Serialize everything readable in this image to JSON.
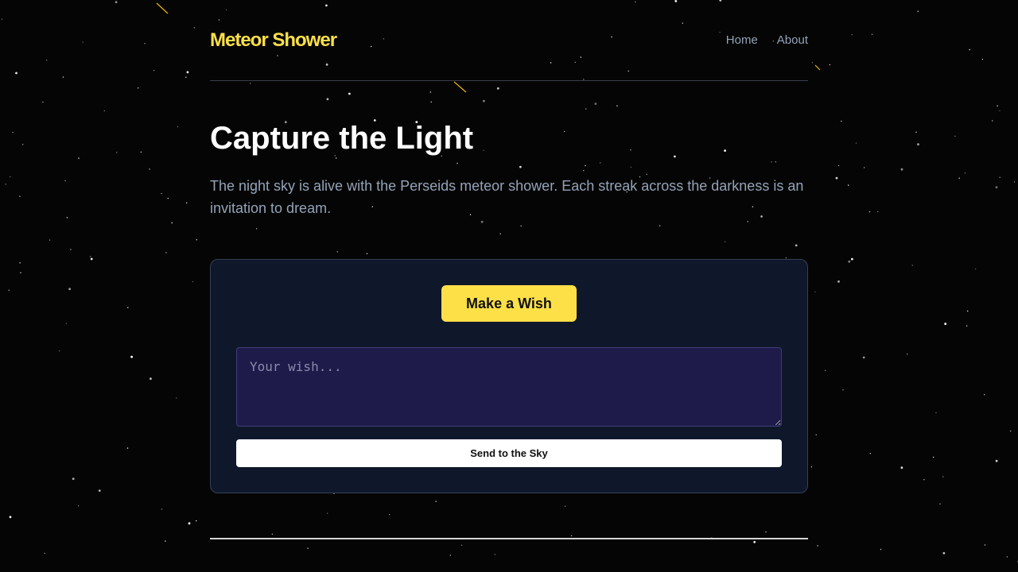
{
  "header": {
    "brand": "Meteor Shower",
    "nav": [
      {
        "label": "Home"
      },
      {
        "label": "About"
      }
    ]
  },
  "hero": {
    "title": "Capture the Light",
    "description": "The night sky is alive with the Perseids meteor shower. Each streak across the darkness is an invitation to dream."
  },
  "wish_card": {
    "wish_button_label": "Make a Wish",
    "wish_placeholder": "Your wish...",
    "send_button_label": "Send to the Sky"
  },
  "colors": {
    "accent": "#fde047",
    "background": "#050505",
    "card": "#0f172a",
    "textarea": "#1e1b4b"
  }
}
